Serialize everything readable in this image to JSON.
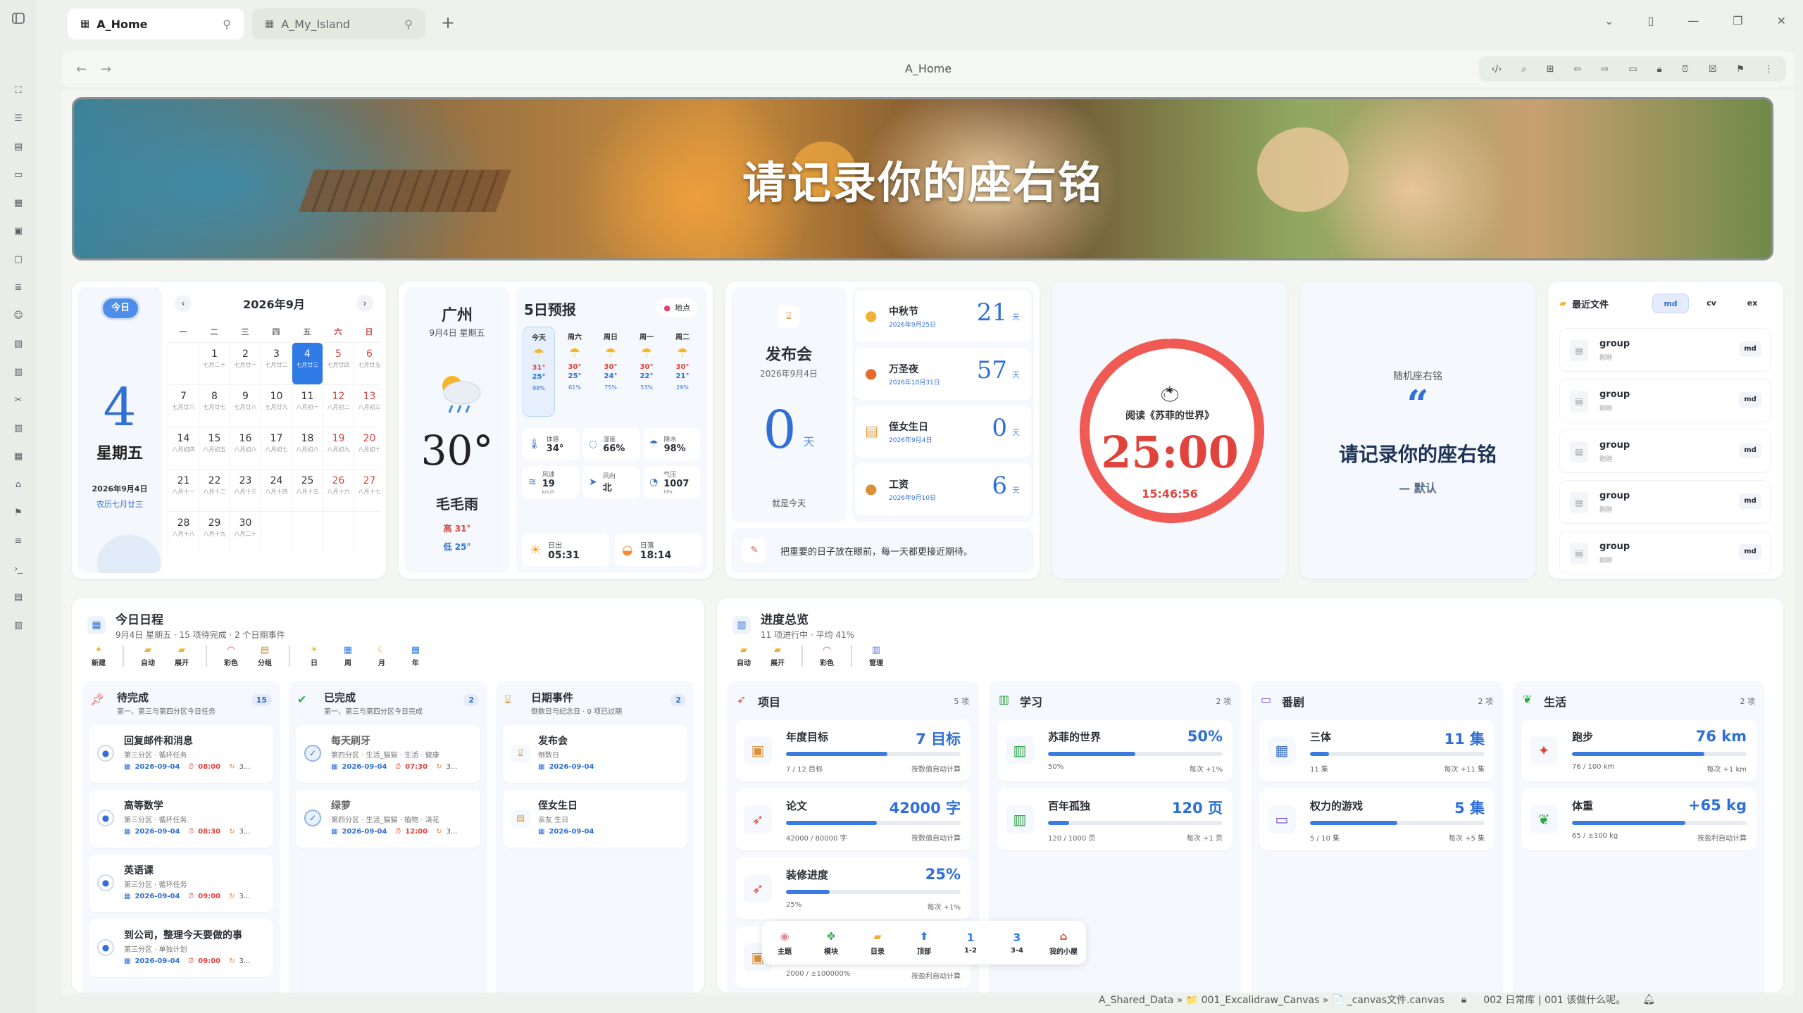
{
  "tabs": [
    {
      "label": "A_Home"
    },
    {
      "label": "A_My_Island"
    }
  ],
  "toolbar": {
    "title": "A_Home"
  },
  "banner": {
    "title": "请记录你的座右铭"
  },
  "calendar": {
    "today_button": "今日",
    "month_label": "2026年9月",
    "big_day": "4",
    "weekday": "星期五",
    "date_line": "2026年9月4日",
    "lunar_line": "农历七月廿三",
    "weekdays": [
      "一",
      "二",
      "三",
      "四",
      "五",
      "六",
      "日"
    ],
    "weeks": [
      [
        {
          "d": "",
          "l": ""
        },
        {
          "d": "1",
          "l": "七月二十"
        },
        {
          "d": "2",
          "l": "七月廿一"
        },
        {
          "d": "3",
          "l": "七月廿二"
        },
        {
          "d": "4",
          "l": "七月廿三"
        },
        {
          "d": "5",
          "l": "七月廿四"
        },
        {
          "d": "6",
          "l": "七月廿五"
        }
      ],
      [
        {
          "d": "7",
          "l": "七月廿六"
        },
        {
          "d": "8",
          "l": "七月廿七"
        },
        {
          "d": "9",
          "l": "七月廿八"
        },
        {
          "d": "10",
          "l": "七月廿九"
        },
        {
          "d": "11",
          "l": "八月初一"
        },
        {
          "d": "12",
          "l": "八月初二"
        },
        {
          "d": "13",
          "l": "八月初三"
        }
      ],
      [
        {
          "d": "14",
          "l": "八月初四"
        },
        {
          "d": "15",
          "l": "八月初五"
        },
        {
          "d": "16",
          "l": "八月初六"
        },
        {
          "d": "17",
          "l": "八月初七"
        },
        {
          "d": "18",
          "l": "八月初八"
        },
        {
          "d": "19",
          "l": "八月初九"
        },
        {
          "d": "20",
          "l": "八月初十"
        }
      ],
      [
        {
          "d": "21",
          "l": "八月十一"
        },
        {
          "d": "22",
          "l": "八月十二"
        },
        {
          "d": "23",
          "l": "八月十三"
        },
        {
          "d": "24",
          "l": "八月十四"
        },
        {
          "d": "25",
          "l": "八月十五"
        },
        {
          "d": "26",
          "l": "八月十六"
        },
        {
          "d": "27",
          "l": "八月十七"
        }
      ],
      [
        {
          "d": "28",
          "l": "八月十八"
        },
        {
          "d": "29",
          "l": "八月十九"
        },
        {
          "d": "30",
          "l": "八月二十"
        },
        {
          "d": "",
          "l": ""
        },
        {
          "d": "",
          "l": ""
        },
        {
          "d": "",
          "l": ""
        },
        {
          "d": "",
          "l": ""
        }
      ]
    ]
  },
  "weather": {
    "city": "广州",
    "date": "9月4日 星期五",
    "temp": "30°",
    "desc": "毛毛雨",
    "high": "高 31°",
    "low": "低 25°",
    "forecast_title": "5日预报",
    "location_button": "地点",
    "forecast": [
      {
        "day": "今天",
        "hi": "31°",
        "lo": "25°",
        "rain": "98%"
      },
      {
        "day": "周六",
        "hi": "30°",
        "lo": "25°",
        "rain": "61%"
      },
      {
        "day": "周日",
        "hi": "30°",
        "lo": "24°",
        "rain": "75%"
      },
      {
        "day": "周一",
        "hi": "30°",
        "lo": "22°",
        "rain": "53%"
      },
      {
        "day": "周二",
        "hi": "30°",
        "lo": "21°",
        "rain": "29%"
      }
    ],
    "stats": [
      {
        "label": "体感",
        "value": "34°"
      },
      {
        "label": "湿度",
        "value": "66%"
      },
      {
        "label": "降水",
        "value": "98%"
      },
      {
        "label": "风速",
        "value": "19",
        "unit": "km/h"
      },
      {
        "label": "风向",
        "value": "北"
      },
      {
        "label": "气压",
        "value": "1007",
        "unit": "hPa"
      }
    ],
    "sunrise": {
      "label": "日出",
      "value": "05:31"
    },
    "sunset": {
      "label": "日落",
      "value": "18:14"
    }
  },
  "countdown": {
    "event": "发布会",
    "event_date": "2026年9月4日",
    "days": "0",
    "unit": "天",
    "note": "就是今天",
    "tip": "把重要的日子放在眼前，每一天都更接近期待。",
    "items": [
      {
        "name": "中秋节",
        "date": "2026年9月25日",
        "days": "21"
      },
      {
        "name": "万圣夜",
        "date": "2026年10月31日",
        "days": "57"
      },
      {
        "name": "侄女生日",
        "date": "2026年9月4日",
        "days": "0"
      },
      {
        "name": "工资",
        "date": "2026年9月10日",
        "days": "6"
      }
    ]
  },
  "pomodoro": {
    "task": "阅读《苏菲的世界》",
    "time": "25:00",
    "clock": "15:46:56",
    "progress": 0.99
  },
  "motto": {
    "label": "随机座右铭",
    "text": "请记录你的座右铭",
    "author": "— 默认"
  },
  "files": {
    "title": "最近文件",
    "tabs": [
      "md",
      "cv",
      "ex"
    ],
    "items": [
      {
        "name": "group",
        "sub": "刚刚",
        "ext": "md"
      },
      {
        "name": "group",
        "sub": "刚刚",
        "ext": "md"
      },
      {
        "name": "group",
        "sub": "刚刚",
        "ext": "md"
      },
      {
        "name": "group",
        "sub": "刚刚",
        "ext": "md"
      },
      {
        "name": "group",
        "sub": "刚刚",
        "ext": "md"
      }
    ]
  },
  "schedule": {
    "title": "今日日程",
    "subtitle": "9月4日 星期五 · 15 项待完成 · 2 个日期事件",
    "buttons": [
      "新建",
      "自动",
      "展开",
      "彩色",
      "分组",
      "日",
      "周",
      "月",
      "年"
    ],
    "columns": [
      {
        "title": "待完成",
        "sub": "第一、第三与第四分区今日任务",
        "count": "15",
        "items": [
          {
            "name": "回复邮件和消息",
            "tag": "第三分区 · 循环任务",
            "date": "2026-09-04",
            "time": "08:00",
            "extra": "3..."
          },
          {
            "name": "高等数学",
            "tag": "第三分区 · 循环任务",
            "date": "2026-09-04",
            "time": "08:30",
            "extra": "3..."
          },
          {
            "name": "英语课",
            "tag": "第三分区 · 循环任务",
            "date": "2026-09-04",
            "time": "09:00",
            "extra": "3..."
          },
          {
            "name": "到公司，整理今天要做的事",
            "tag": "第三分区 · 单独计划",
            "date": "2026-09-04",
            "time": "09:00",
            "extra": "3..."
          }
        ]
      },
      {
        "title": "已完成",
        "sub": "第一、第三与第四分区今日完成",
        "count": "2",
        "items": [
          {
            "name": "每天刷牙",
            "tag": "第四分区 · 生活_猫猫 · 生活 · 健康",
            "date": "2026-09-04",
            "time": "07:30",
            "extra": "3..."
          },
          {
            "name": "绿萝",
            "tag": "第四分区 · 生活_猫猫 · 植物 · 浇花",
            "date": "2026-09-04",
            "time": "12:00",
            "extra": "3..."
          }
        ]
      },
      {
        "title": "日期事件",
        "sub": "倒数日与纪念日 · 0 项已过期",
        "count": "2",
        "items": [
          {
            "name": "发布会",
            "tag": "倒数日",
            "date": "2026-09-04"
          },
          {
            "name": "侄女生日",
            "tag": "亲友 生日",
            "date": "2026-09-04"
          }
        ]
      }
    ]
  },
  "progress": {
    "title": "进度总览",
    "subtitle": "11 项进行中 · 平均 41%",
    "buttons": [
      "自动",
      "展开",
      "彩色",
      "管理"
    ],
    "groups": [
      {
        "name": "项目",
        "count": "5 项",
        "items": [
          {
            "name": "年度目标",
            "value": "7 目标",
            "frac": 0.58,
            "left": "7 / 12 目标",
            "right": "按数值自动计算"
          },
          {
            "name": "论文",
            "value": "42000 字",
            "frac": 0.52,
            "left": "42000 / 80000 字",
            "right": "按数值自动计算"
          },
          {
            "name": "装修进度",
            "value": "25%",
            "frac": 0.25,
            "left": "25%",
            "right": "每次 +1%"
          },
          {
            "name": "",
            "value": "",
            "frac": 0.02,
            "left": "2000 / ±100000%",
            "right": "按盈利自动计算"
          }
        ]
      },
      {
        "name": "学习",
        "count": "2 项",
        "items": [
          {
            "name": "苏菲的世界",
            "value": "50%",
            "frac": 0.5,
            "left": "50%",
            "right": "每次 +1%"
          },
          {
            "name": "百年孤独",
            "value": "120 页",
            "frac": 0.12,
            "left": "120 / 1000 页",
            "right": "每次 +1 页"
          }
        ]
      },
      {
        "name": "番剧",
        "count": "2 项",
        "items": [
          {
            "name": "三体",
            "value": "11 集",
            "frac": 0.11,
            "left": "11 集",
            "right": "每次 +11 集"
          },
          {
            "name": "权力的游戏",
            "value": "5 集",
            "frac": 0.5,
            "left": "5 / 10 集",
            "right": "每次 +5 集"
          }
        ]
      },
      {
        "name": "生活",
        "count": "2 项",
        "items": [
          {
            "name": "跑步",
            "value": "76 km",
            "frac": 0.76,
            "left": "76 / 100 km",
            "right": "每次 +1 km"
          },
          {
            "name": "体重",
            "value": "+65 kg",
            "frac": 0.65,
            "left": "65 / ±100 kg",
            "right": "按盈利自动计算"
          }
        ]
      }
    ]
  },
  "float_nav": [
    "主题",
    "模块",
    "目录",
    "顶部",
    "1-2",
    "3-4",
    "我的小屋"
  ],
  "statusbar": {
    "path": "A_Shared_Data » 📁 001_Excalidraw_Canvas » 📄 _canvas文件.canvas",
    "info": "002 日常库 | 001 该做什么呢。"
  }
}
